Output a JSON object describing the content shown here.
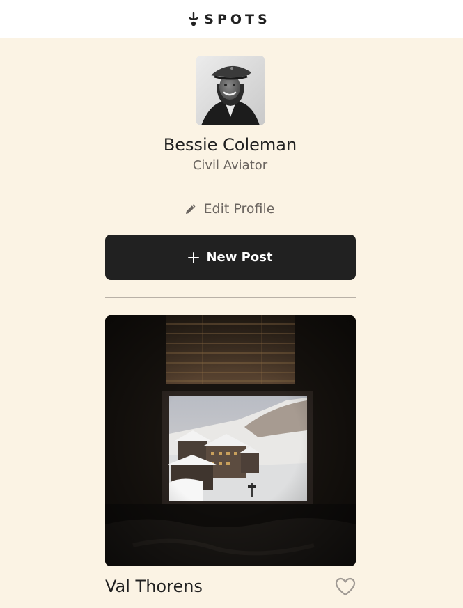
{
  "header": {
    "logo_text": "SPOTS",
    "logo_icon": "spots-logo-icon"
  },
  "profile": {
    "name": "Bessie Coleman",
    "title": "Civil Aviator",
    "avatar": "avatar-portrait",
    "edit_label": "Edit Profile",
    "edit_icon": "pencil-icon"
  },
  "actions": {
    "new_post_label": "New Post",
    "new_post_icon": "plus-icon"
  },
  "cards": [
    {
      "title": "Val Thorens",
      "image": "window-view-snowy-village",
      "liked": false,
      "like_icon": "heart-outline-icon"
    }
  ],
  "colors": {
    "background": "#fbf3e4",
    "header": "#ffffff",
    "text_primary": "#212121",
    "text_secondary": "#6b6560",
    "button": "#212121",
    "button_text": "#ffffff",
    "divider": "#b9b1a7"
  }
}
